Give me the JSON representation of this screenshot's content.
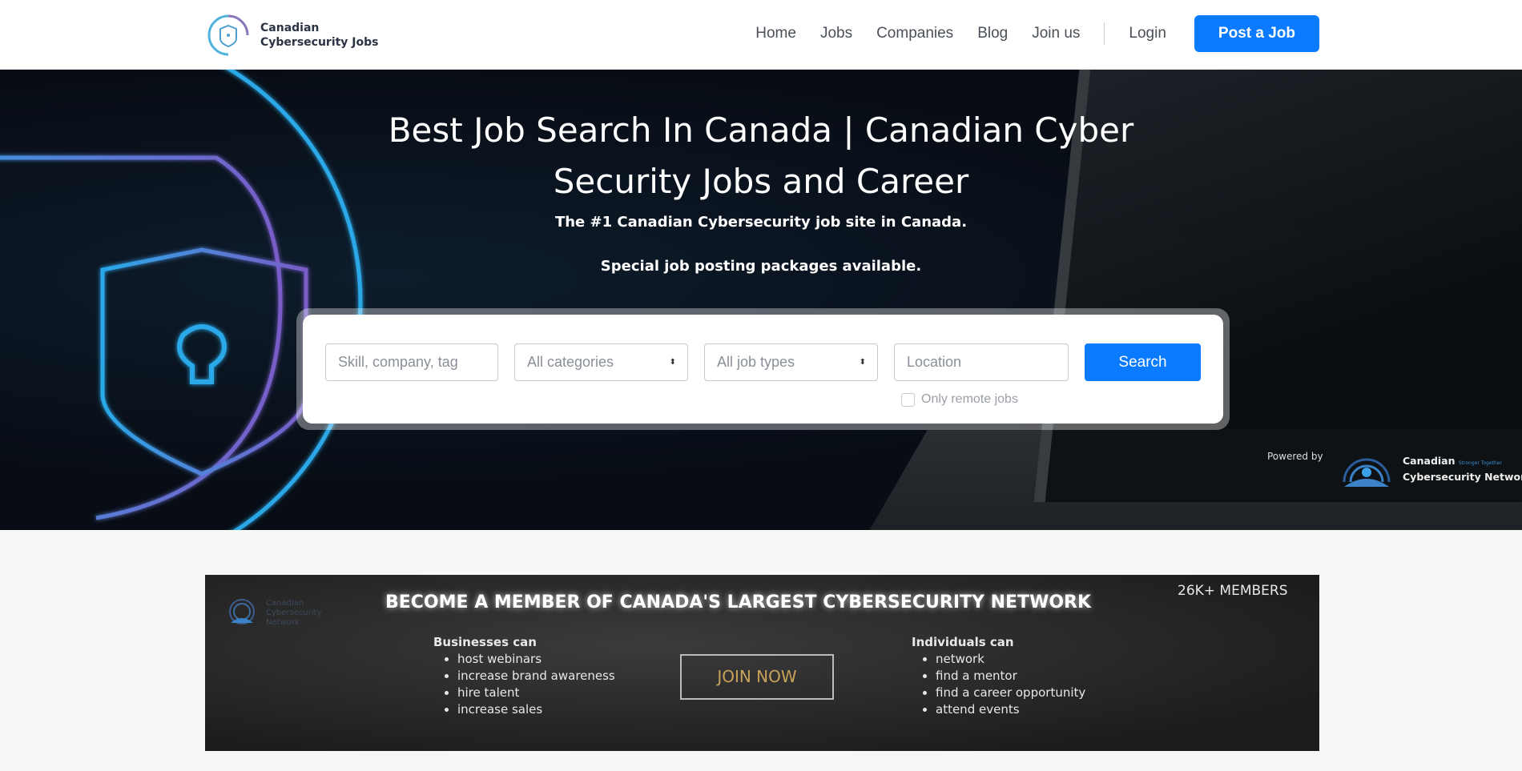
{
  "header": {
    "logo_line1": "Canadian",
    "logo_line2": "Cybersecurity Jobs",
    "nav": [
      "Home",
      "Jobs",
      "Companies",
      "Blog",
      "Join us"
    ],
    "login": "Login",
    "post_job": "Post a Job"
  },
  "hero": {
    "title": "Best Job Search In Canada | Canadian Cyber Security Jobs and Career",
    "subtitle": "The #1 Canadian Cybersecurity job site in Canada.",
    "subtitle2": "Special job posting packages available.",
    "search": {
      "keyword_placeholder": "Skill, company, tag",
      "category": "All categories",
      "job_type": "All job types",
      "location_placeholder": "Location",
      "button": "Search",
      "remote_label": "Only remote jobs",
      "remote_checked": false
    },
    "powered_by": "Powered by",
    "network_line1": "Canadian",
    "network_tagline": "Stronger Together",
    "network_line2": "Cybersecurity Network"
  },
  "banner": {
    "title": "BECOME A MEMBER OF CANADA'S LARGEST CYBERSECURITY NETWORK",
    "members": "26K+ MEMBERS",
    "logo_text": "Canadian Cybersecurity Network",
    "businesses_heading": "Businesses can",
    "businesses": [
      "host webinars",
      "increase brand awareness",
      "hire talent",
      "increase sales"
    ],
    "join": "JOIN NOW",
    "individuals_heading": "Individuals can",
    "individuals": [
      "network",
      "find a mentor",
      "find a career opportunity",
      "attend events"
    ]
  },
  "colors": {
    "accent": "#0a7bff",
    "join_text": "#c9a25a"
  }
}
